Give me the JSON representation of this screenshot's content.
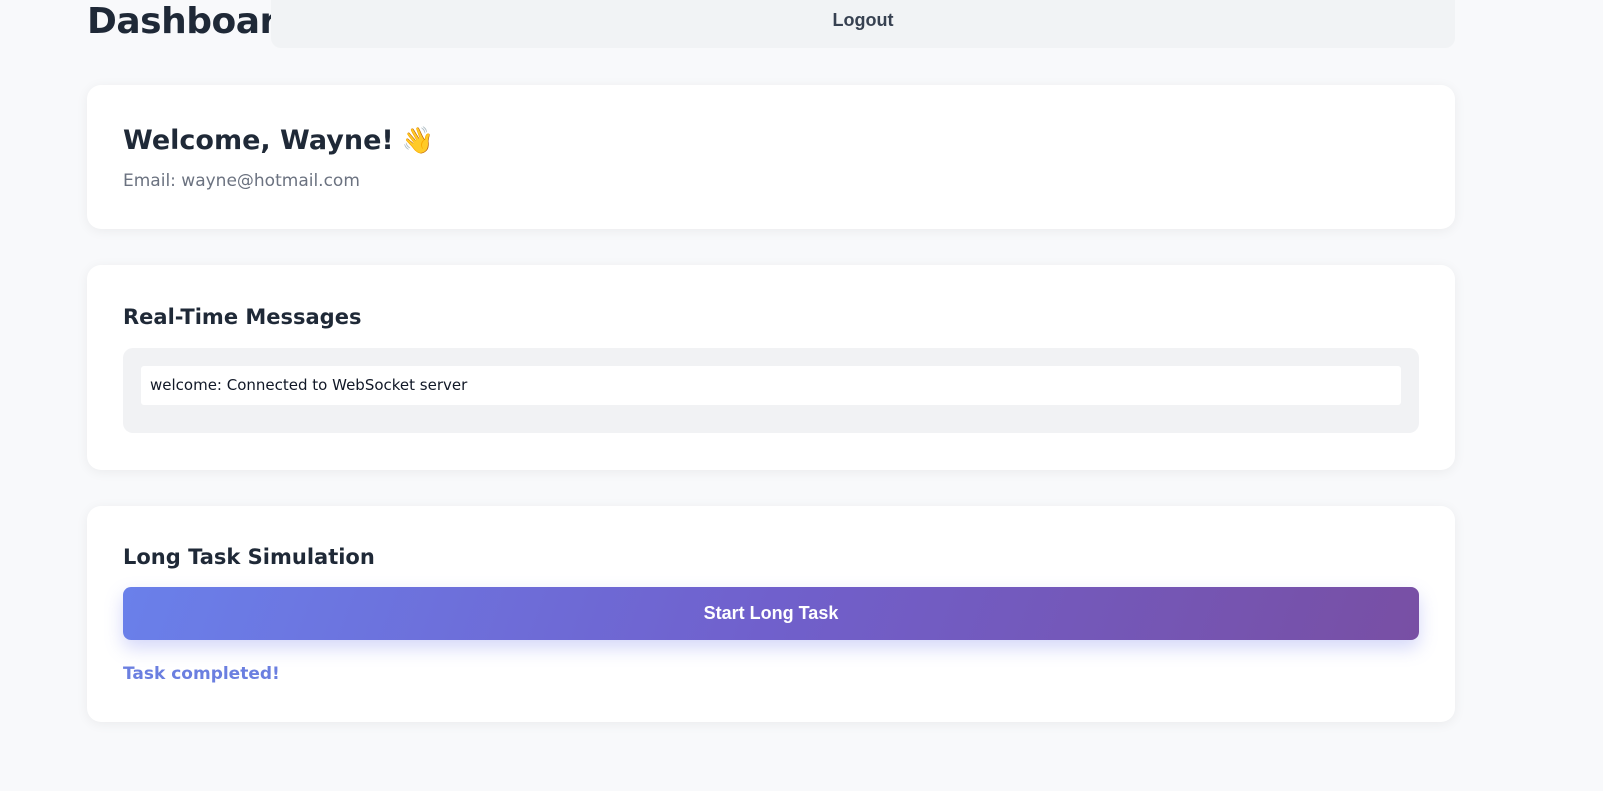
{
  "header": {
    "title": "Dashboard",
    "logout_label": "Logout"
  },
  "welcome": {
    "greeting": "Welcome, Wayne!",
    "emoji": "👋",
    "email_line": "Email: wayne@hotmail.com"
  },
  "messages": {
    "title": "Real-Time Messages",
    "items": [
      {
        "text": "welcome: Connected to WebSocket server"
      }
    ]
  },
  "task": {
    "title": "Long Task Simulation",
    "button_label": "Start Long Task",
    "status": "Task completed!"
  },
  "colors": {
    "background": "#f8f9fb",
    "accent_start": "#6a80ea",
    "accent_end": "#784fa4",
    "status_text": "#6b7fe0"
  }
}
